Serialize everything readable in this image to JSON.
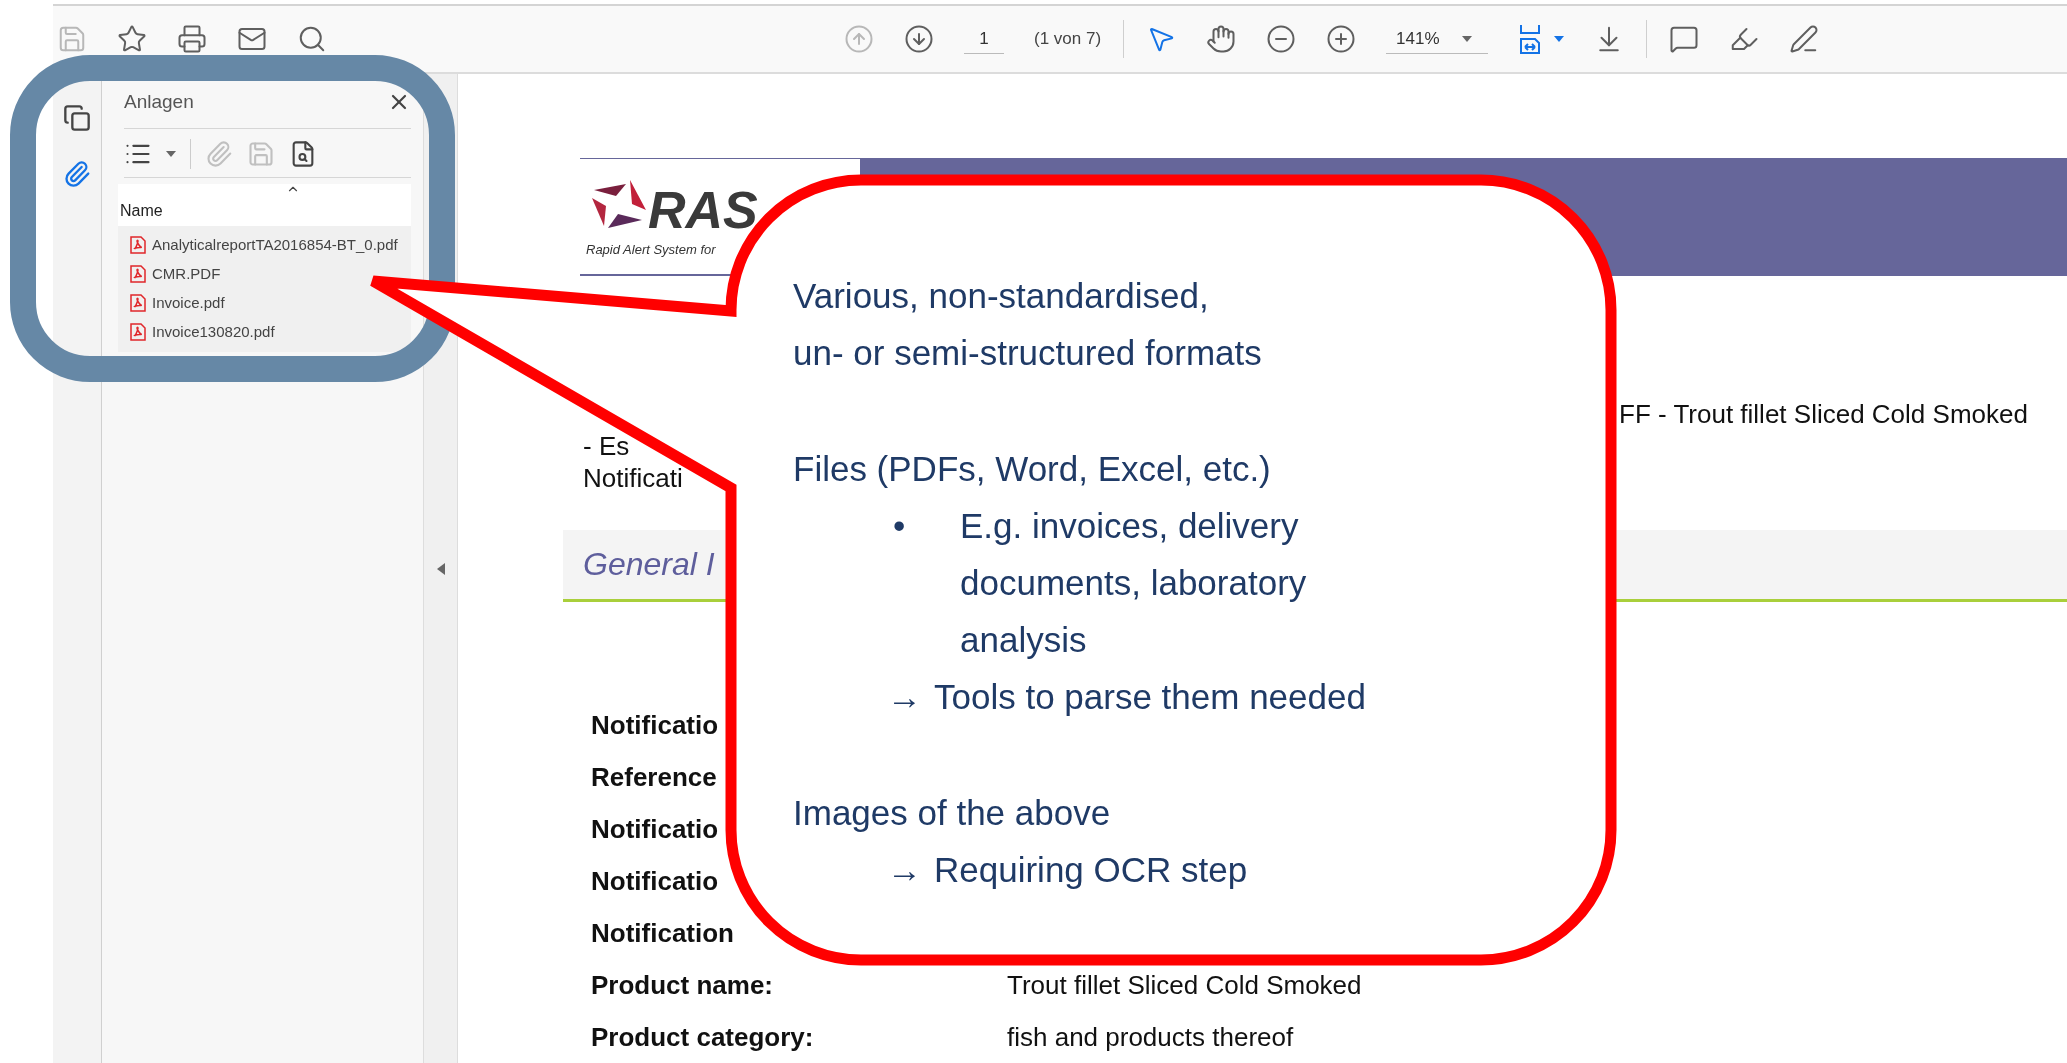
{
  "toolbar": {
    "file_tools": [
      {
        "kind": "save",
        "disabled": true
      },
      {
        "kind": "bookmark",
        "disabled": false
      },
      {
        "kind": "print",
        "disabled": false
      },
      {
        "kind": "email",
        "disabled": false
      },
      {
        "kind": "search",
        "disabled": false
      }
    ],
    "nav_tools": [
      {
        "kind": "up",
        "disabled": true
      },
      {
        "kind": "down",
        "disabled": false
      }
    ],
    "page_number": "1",
    "page_count": "(1 von 7)",
    "mode_tools": [
      {
        "kind": "select",
        "selected": true
      },
      {
        "kind": "hand",
        "selected": false
      }
    ],
    "zoom": "141%"
  },
  "side_rail": {
    "tabs": [
      {
        "kind": "pages",
        "selected": false
      },
      {
        "kind": "attachments",
        "selected": true
      }
    ]
  },
  "attachments_panel": {
    "title": "Anlagen",
    "tools": [
      {
        "kind": "view",
        "disabled": false
      },
      {
        "kind": "add",
        "disabled": true
      },
      {
        "kind": "save",
        "disabled": true
      },
      {
        "kind": "search",
        "disabled": false
      }
    ],
    "column_header": "Name",
    "files": [
      "AnalyticalreportTA2016854-BT_0.pdf",
      "CMR.PDF",
      "Invoice.pdf",
      "Invoice130820.pdf"
    ]
  },
  "document": {
    "logo_text": "RAS",
    "logo_tagline": "Rapid Alert System for",
    "line_end": "FF - Trout fillet Sliced Cold Smoked",
    "lines": [
      "- Es",
      "Notificati"
    ],
    "section_title": "General I",
    "rows": [
      {
        "label": "Notificatio"
      },
      {
        "label": "Reference"
      },
      {
        "label": "Notificatio"
      },
      {
        "label": "Notificatio"
      },
      {
        "label": "Notification"
      },
      {
        "label": "Product name:",
        "value": "Trout fillet Sliced Cold Smoked"
      },
      {
        "label": "Product category:",
        "value": "fish and products thereof"
      }
    ]
  },
  "callout": {
    "lines": [
      {
        "kind": "text",
        "text": "Various, non-standardised,"
      },
      {
        "kind": "text",
        "text": "un- or semi-structured formats"
      },
      {
        "kind": "gap"
      },
      {
        "kind": "text",
        "text": "Files (PDFs, Word, Excel, etc.)"
      },
      {
        "kind": "bullet",
        "marker": "•",
        "text": "E.g. invoices, delivery documents, laboratory analysis"
      },
      {
        "kind": "arrow",
        "marker": "→",
        "text": "Tools to parse them needed"
      },
      {
        "kind": "gap"
      },
      {
        "kind": "text",
        "text": "Images of the above"
      },
      {
        "kind": "arrow",
        "marker": "→",
        "text": "Requiring OCR step"
      }
    ]
  }
}
